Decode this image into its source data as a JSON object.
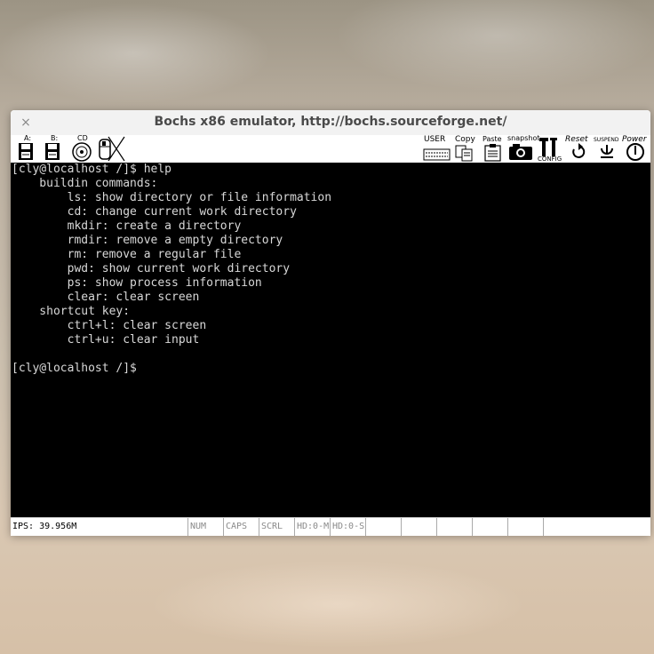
{
  "window": {
    "title": "Bochs x86 emulator, http://bochs.sourceforge.net/",
    "close_glyph": "×"
  },
  "toolbar": {
    "floppy_a_label": "A:",
    "floppy_b_label": "B:",
    "cdrom_label": "CD",
    "user_label": "USER",
    "copy_label": "Copy",
    "paste_label": "Paste",
    "snapshot_label": "snapshot",
    "config_label": "CONFIG",
    "reset_label": "Reset",
    "suspend_label": "SUSPEND",
    "power_label": "Power"
  },
  "terminal": {
    "lines": [
      "[cly@localhost /]$ help",
      "    buildin commands:",
      "        ls: show directory or file information",
      "        cd: change current work directory",
      "        mkdir: create a directory",
      "        rmdir: remove a empty directory",
      "        rm: remove a regular file",
      "        pwd: show current work directory",
      "        ps: show process information",
      "        clear: clear screen",
      "    shortcut key:",
      "        ctrl+l: clear screen",
      "        ctrl+u: clear input",
      "",
      "[cly@localhost /]$"
    ]
  },
  "statusbar": {
    "ips": "IPS: 39.956M",
    "num": "NUM",
    "caps": "CAPS",
    "scrl": "SCRL",
    "hd0m": "HD:0-M",
    "hd0s": "HD:0-S"
  }
}
